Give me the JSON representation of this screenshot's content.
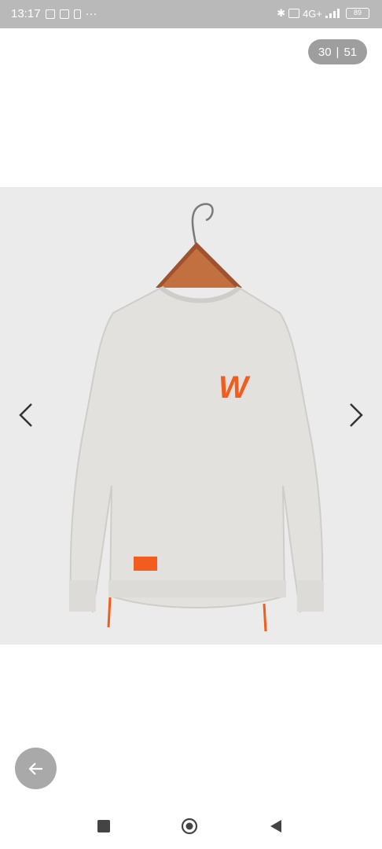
{
  "status_bar": {
    "time": "13:17",
    "more": "···",
    "network": "4G+",
    "battery": "89"
  },
  "gallery": {
    "current": "30",
    "separator": "|",
    "total": "51",
    "image_alt": "Light grey crewneck sweatshirt with orange W logo on a hanger"
  },
  "colors": {
    "status_bar": "#b9b9b9",
    "counter_bg": "#9e9e9e",
    "photo_bg": "#ebebeb",
    "accent_orange": "#f25c1e"
  },
  "icons": {
    "prev": "chevron-left-icon",
    "next": "chevron-right-icon",
    "back": "arrow-left-icon",
    "recent": "square-icon",
    "home": "circle-icon",
    "navback": "triangle-left-icon"
  }
}
